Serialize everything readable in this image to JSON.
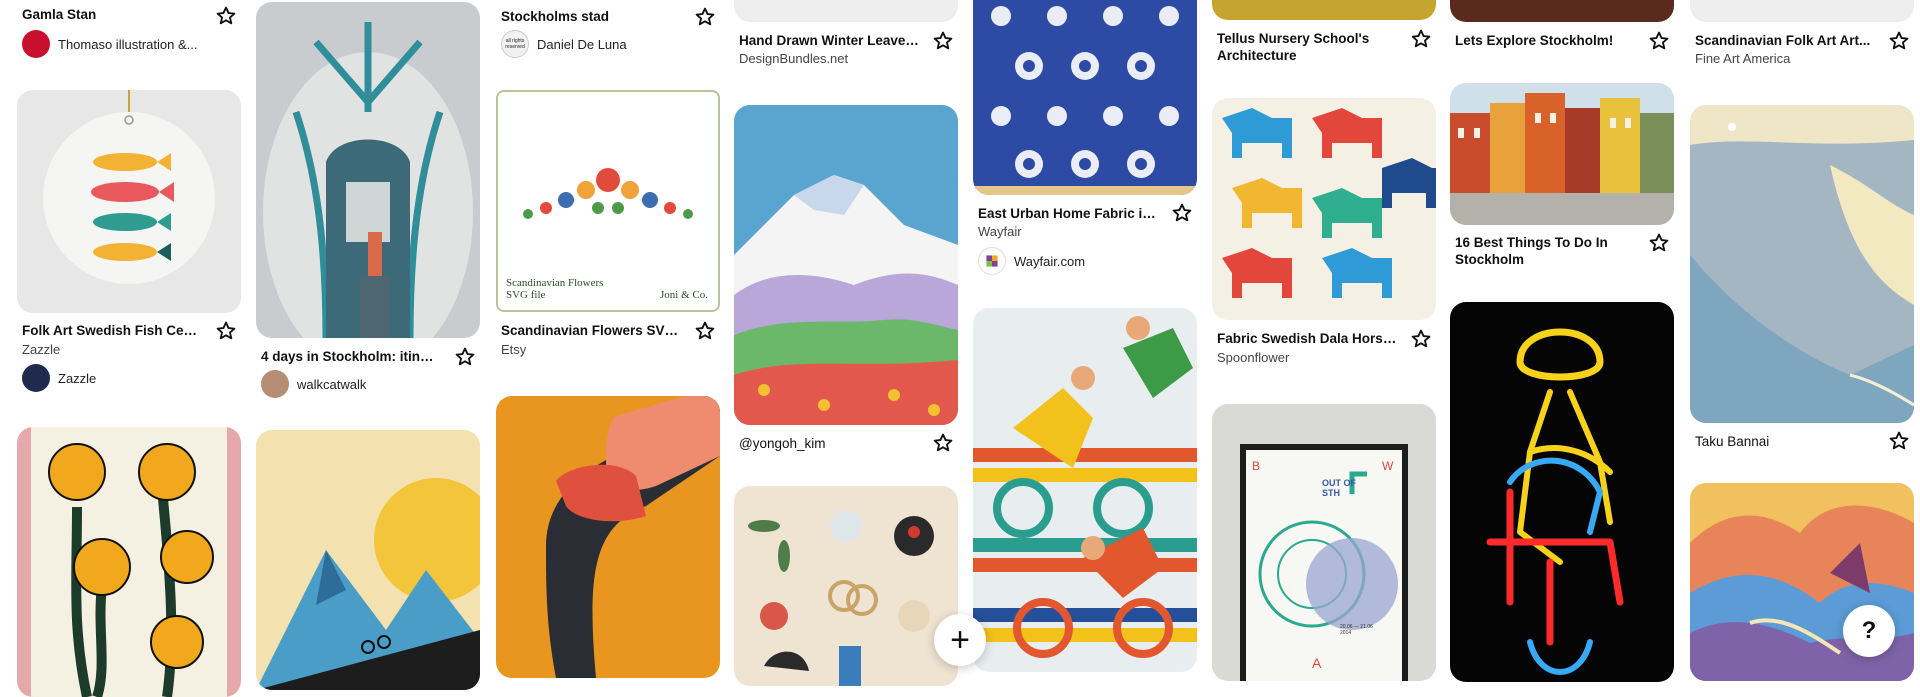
{
  "pins": {
    "c1p1": {
      "title": "Gamla Stan",
      "source": "Thomaso illustration &..."
    },
    "c1p2": {
      "title": "Folk Art Swedish Fish Ceram...",
      "sub": "Zazzle",
      "source": "Zazzle"
    },
    "c2p1": {
      "title": "4 days in Stockholm: itinera...",
      "source": "walkcatwalk"
    },
    "c3p1": {
      "title": "Stockholms stad",
      "source": "Daniel De Luna",
      "avatar_text": "all rights reserved"
    },
    "c3p2": {
      "title": "Scandinavian Flowers SVG,...",
      "sub": "Etsy",
      "img_caption_left": "Scandinavian Flowers",
      "img_caption_left2": "SVG file",
      "img_caption_right": "Joni & Co."
    },
    "c4p1": {
      "title": "Hand Drawn Winter Leaves...",
      "sub": "DesignBundles.net"
    },
    "c4p2": {
      "title": "@yongoh_kim"
    },
    "c5p1": {
      "title": "East Urban Home Fabric in...",
      "sub": "Wayfair",
      "source": "Wayfair.com"
    },
    "c6p1": {
      "title": "Tellus Nursery School's Architecture"
    },
    "c6p2": {
      "title": "Fabric Swedish Dala Horses",
      "sub": "Spoonflower"
    },
    "c6p3": {
      "poster_text": "OUT OF STH",
      "poster_date": "20.06 — 21.06 2014"
    },
    "c7p1": {
      "title": "Lets Explore Stockholm!"
    },
    "c7p2": {
      "title": "16 Best Things To Do In Stockholm"
    },
    "c8p1": {
      "title": "Scandinavian Folk Art Art...",
      "sub": "Fine Art America"
    },
    "c8p2": {
      "title": "Taku Bannai"
    }
  },
  "fab": {
    "add_label": "+",
    "help_label": "?"
  },
  "colors": {
    "accent_red": "#e60023"
  },
  "icons": {
    "save": "star-icon",
    "add": "plus-icon",
    "help": "question-icon"
  }
}
